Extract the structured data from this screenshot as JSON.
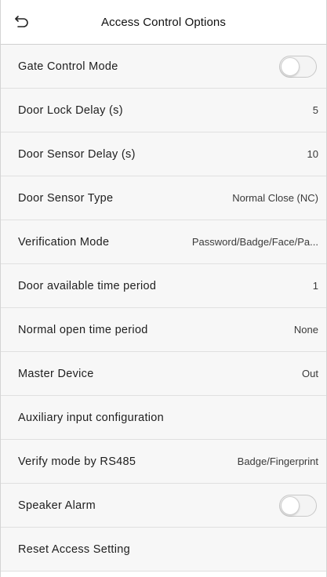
{
  "header": {
    "title": "Access Control Options",
    "back_icon": "back-arrow-icon"
  },
  "rows": [
    {
      "label": "Gate Control Mode",
      "type": "toggle",
      "on": false
    },
    {
      "label": "Door Lock Delay (s)",
      "type": "value",
      "value": "5"
    },
    {
      "label": "Door Sensor Delay (s)",
      "type": "value",
      "value": "10"
    },
    {
      "label": "Door Sensor Type",
      "type": "value",
      "value": "Normal Close (NC)"
    },
    {
      "label": "Verification Mode",
      "type": "value",
      "value": "Password/Badge/Face/Pa..."
    },
    {
      "label": "Door available time period",
      "type": "value",
      "value": "1"
    },
    {
      "label": "Normal open time period",
      "type": "value",
      "value": "None"
    },
    {
      "label": "Master Device",
      "type": "value",
      "value": "Out"
    },
    {
      "label": "Auxiliary input configuration",
      "type": "none"
    },
    {
      "label": "Verify mode by RS485",
      "type": "value",
      "value": "Badge/Fingerprint"
    },
    {
      "label": "Speaker Alarm",
      "type": "toggle",
      "on": false
    },
    {
      "label": "Reset Access Setting",
      "type": "none"
    }
  ],
  "colors": {
    "row_background": "#f7f7f7",
    "divider": "#e0e0e0",
    "toggle_off": "#f4f4f4"
  }
}
